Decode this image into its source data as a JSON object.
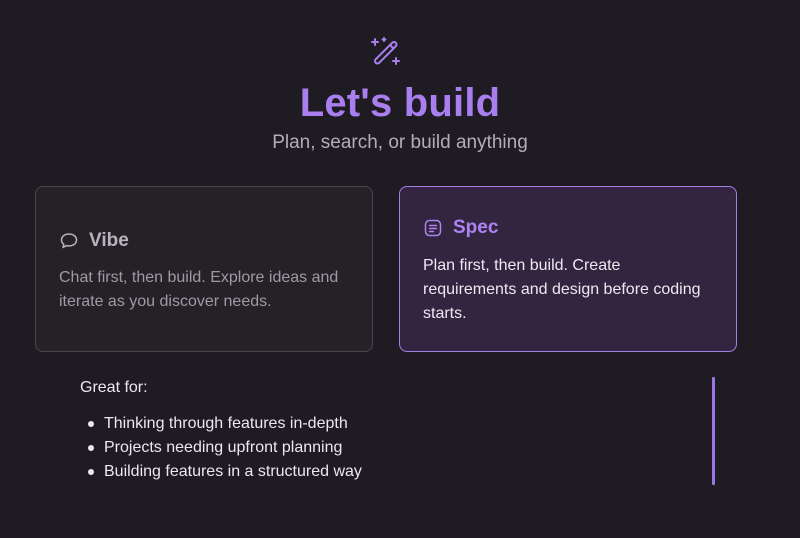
{
  "hero": {
    "icon": "magic-wand-icon",
    "title": "Let's build",
    "subtitle": "Plan, search, or build anything"
  },
  "modes": {
    "vibe": {
      "icon": "chat-bubble-icon",
      "title": "Vibe",
      "description": "Chat first, then build. Explore ideas and iterate as you discover needs.",
      "selected": false
    },
    "spec": {
      "icon": "document-lines-icon",
      "title": "Spec",
      "description": "Plan first, then build. Create requirements and design before coding starts.",
      "selected": true
    }
  },
  "details": {
    "heading": "Great for:",
    "items": [
      "Thinking through features in-depth",
      "Projects needing upfront planning",
      "Building features in a structured way"
    ]
  },
  "colors": {
    "background": "#1f1b22",
    "accent": "#a97ff0",
    "selected_card_bg": "#33253f",
    "card_bg": "#252227"
  }
}
